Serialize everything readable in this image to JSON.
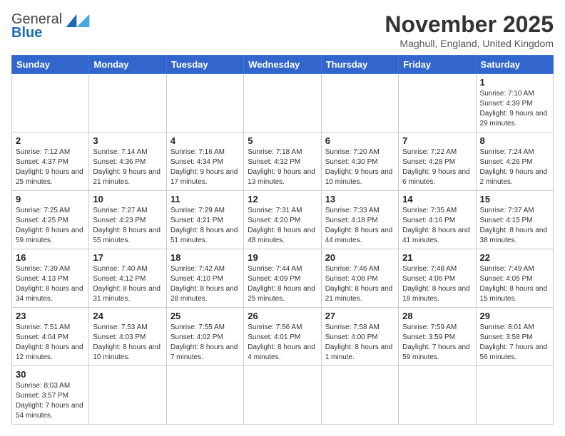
{
  "header": {
    "logo_line1": "General",
    "logo_line2": "Blue",
    "month_title": "November 2025",
    "location": "Maghull, England, United Kingdom"
  },
  "weekdays": [
    "Sunday",
    "Monday",
    "Tuesday",
    "Wednesday",
    "Thursday",
    "Friday",
    "Saturday"
  ],
  "weeks": [
    [
      {
        "day": "",
        "info": ""
      },
      {
        "day": "",
        "info": ""
      },
      {
        "day": "",
        "info": ""
      },
      {
        "day": "",
        "info": ""
      },
      {
        "day": "",
        "info": ""
      },
      {
        "day": "",
        "info": ""
      },
      {
        "day": "1",
        "info": "Sunrise: 7:10 AM\nSunset: 4:39 PM\nDaylight: 9 hours and 29 minutes."
      }
    ],
    [
      {
        "day": "2",
        "info": "Sunrise: 7:12 AM\nSunset: 4:37 PM\nDaylight: 9 hours and 25 minutes."
      },
      {
        "day": "3",
        "info": "Sunrise: 7:14 AM\nSunset: 4:36 PM\nDaylight: 9 hours and 21 minutes."
      },
      {
        "day": "4",
        "info": "Sunrise: 7:16 AM\nSunset: 4:34 PM\nDaylight: 9 hours and 17 minutes."
      },
      {
        "day": "5",
        "info": "Sunrise: 7:18 AM\nSunset: 4:32 PM\nDaylight: 9 hours and 13 minutes."
      },
      {
        "day": "6",
        "info": "Sunrise: 7:20 AM\nSunset: 4:30 PM\nDaylight: 9 hours and 10 minutes."
      },
      {
        "day": "7",
        "info": "Sunrise: 7:22 AM\nSunset: 4:28 PM\nDaylight: 9 hours and 6 minutes."
      },
      {
        "day": "8",
        "info": "Sunrise: 7:24 AM\nSunset: 4:26 PM\nDaylight: 9 hours and 2 minutes."
      }
    ],
    [
      {
        "day": "9",
        "info": "Sunrise: 7:25 AM\nSunset: 4:25 PM\nDaylight: 8 hours and 59 minutes."
      },
      {
        "day": "10",
        "info": "Sunrise: 7:27 AM\nSunset: 4:23 PM\nDaylight: 8 hours and 55 minutes."
      },
      {
        "day": "11",
        "info": "Sunrise: 7:29 AM\nSunset: 4:21 PM\nDaylight: 8 hours and 51 minutes."
      },
      {
        "day": "12",
        "info": "Sunrise: 7:31 AM\nSunset: 4:20 PM\nDaylight: 8 hours and 48 minutes."
      },
      {
        "day": "13",
        "info": "Sunrise: 7:33 AM\nSunset: 4:18 PM\nDaylight: 8 hours and 44 minutes."
      },
      {
        "day": "14",
        "info": "Sunrise: 7:35 AM\nSunset: 4:16 PM\nDaylight: 8 hours and 41 minutes."
      },
      {
        "day": "15",
        "info": "Sunrise: 7:37 AM\nSunset: 4:15 PM\nDaylight: 8 hours and 38 minutes."
      }
    ],
    [
      {
        "day": "16",
        "info": "Sunrise: 7:39 AM\nSunset: 4:13 PM\nDaylight: 8 hours and 34 minutes."
      },
      {
        "day": "17",
        "info": "Sunrise: 7:40 AM\nSunset: 4:12 PM\nDaylight: 8 hours and 31 minutes."
      },
      {
        "day": "18",
        "info": "Sunrise: 7:42 AM\nSunset: 4:10 PM\nDaylight: 8 hours and 28 minutes."
      },
      {
        "day": "19",
        "info": "Sunrise: 7:44 AM\nSunset: 4:09 PM\nDaylight: 8 hours and 25 minutes."
      },
      {
        "day": "20",
        "info": "Sunrise: 7:46 AM\nSunset: 4:08 PM\nDaylight: 8 hours and 21 minutes."
      },
      {
        "day": "21",
        "info": "Sunrise: 7:48 AM\nSunset: 4:06 PM\nDaylight: 8 hours and 18 minutes."
      },
      {
        "day": "22",
        "info": "Sunrise: 7:49 AM\nSunset: 4:05 PM\nDaylight: 8 hours and 15 minutes."
      }
    ],
    [
      {
        "day": "23",
        "info": "Sunrise: 7:51 AM\nSunset: 4:04 PM\nDaylight: 8 hours and 12 minutes."
      },
      {
        "day": "24",
        "info": "Sunrise: 7:53 AM\nSunset: 4:03 PM\nDaylight: 8 hours and 10 minutes."
      },
      {
        "day": "25",
        "info": "Sunrise: 7:55 AM\nSunset: 4:02 PM\nDaylight: 8 hours and 7 minutes."
      },
      {
        "day": "26",
        "info": "Sunrise: 7:56 AM\nSunset: 4:01 PM\nDaylight: 8 hours and 4 minutes."
      },
      {
        "day": "27",
        "info": "Sunrise: 7:58 AM\nSunset: 4:00 PM\nDaylight: 8 hours and 1 minute."
      },
      {
        "day": "28",
        "info": "Sunrise: 7:59 AM\nSunset: 3:59 PM\nDaylight: 7 hours and 59 minutes."
      },
      {
        "day": "29",
        "info": "Sunrise: 8:01 AM\nSunset: 3:58 PM\nDaylight: 7 hours and 56 minutes."
      }
    ],
    [
      {
        "day": "30",
        "info": "Sunrise: 8:03 AM\nSunset: 3:57 PM\nDaylight: 7 hours and 54 minutes."
      },
      {
        "day": "",
        "info": ""
      },
      {
        "day": "",
        "info": ""
      },
      {
        "day": "",
        "info": ""
      },
      {
        "day": "",
        "info": ""
      },
      {
        "day": "",
        "info": ""
      },
      {
        "day": "",
        "info": ""
      }
    ]
  ]
}
